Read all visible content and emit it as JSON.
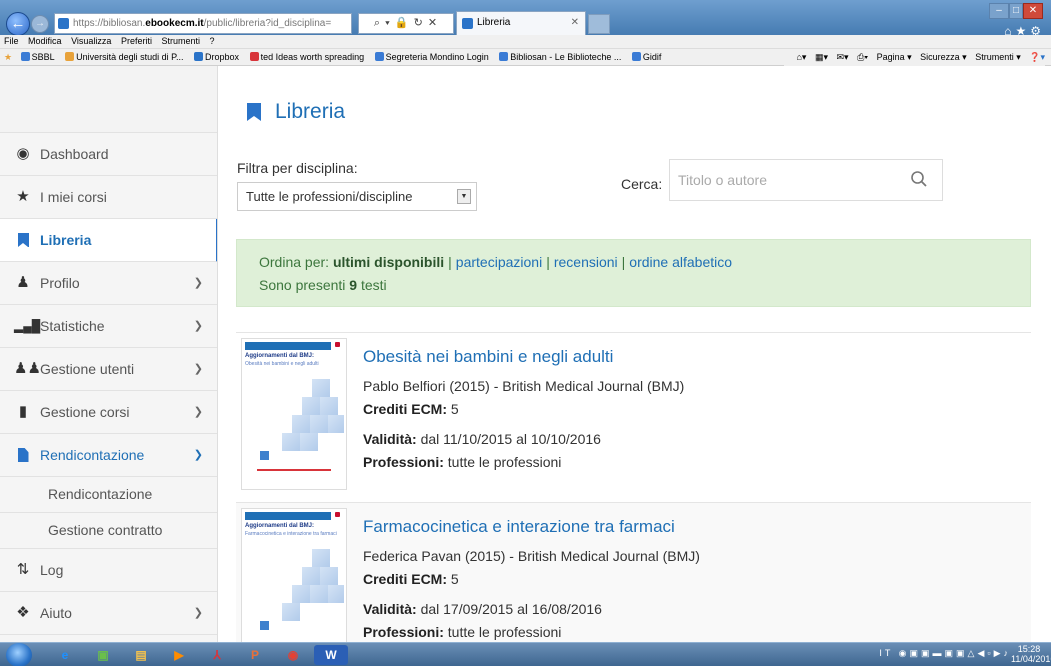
{
  "browser": {
    "url_prefix": "https://bibliosan.",
    "url_domain": "ebookecm.it",
    "url_suffix": "/public/libreria?id_disciplina=",
    "addr_tools": "⌕ ▾ 🔒 ↻ ✕",
    "tab_label": "Libreria",
    "menu": [
      "File",
      "Modifica",
      "Visualizza",
      "Preferiti",
      "Strumenti",
      "?"
    ],
    "favorites": [
      {
        "label": "SBBL",
        "color": "#3a7bd5"
      },
      {
        "label": "Università degli studi di P...",
        "color": "#e8a23a"
      },
      {
        "label": "Dropbox",
        "color": "#2a73c8"
      },
      {
        "label": "ted Ideas worth spreading",
        "color": "#d8343a"
      },
      {
        "label": "Segreteria Mondino Login",
        "color": "#3a7bd5"
      },
      {
        "label": "Bibliosan - Le Biblioteche ...",
        "color": "#3a7bd5"
      },
      {
        "label": "Gidif",
        "color": "#3a7bd5"
      }
    ],
    "command_bar": [
      "Pagina ▾",
      "Sicurezza ▾",
      "Strumenti ▾"
    ]
  },
  "sidebar": {
    "items": [
      {
        "label": "Dashboard",
        "icon": "dashboard-icon"
      },
      {
        "label": "I miei corsi",
        "icon": "star-icon"
      },
      {
        "label": "Libreria",
        "icon": "bookmark-icon",
        "active": true
      },
      {
        "label": "Profilo",
        "icon": "user-icon"
      },
      {
        "label": "Statistiche",
        "icon": "bar-chart-icon"
      },
      {
        "label": "Gestione utenti",
        "icon": "users-icon"
      },
      {
        "label": "Gestione corsi",
        "icon": "book-icon"
      },
      {
        "label": "Rendicontazione",
        "icon": "file-icon",
        "open": true
      },
      {
        "label": "Log",
        "icon": "sort-icon"
      },
      {
        "label": "Aiuto",
        "icon": "info-icon"
      }
    ],
    "sub_items": [
      "Rendicontazione",
      "Gestione contratto"
    ]
  },
  "main": {
    "title": "Libreria",
    "filter": {
      "label": "Filtra per disciplina:",
      "selected": "Tutte le professioni/discipline"
    },
    "search": {
      "label": "Cerca:",
      "placeholder": "Titolo o autore",
      "value": ""
    },
    "sort": {
      "prefix": "Ordina per:",
      "selected": "ultimi disponibili",
      "options": [
        "partecipazioni",
        "recensioni",
        "ordine alfabetico"
      ],
      "count_prefix": "Sono presenti",
      "count": "9",
      "count_suffix": "testi"
    },
    "field_labels": {
      "credits": "Crediti ECM:",
      "validity": "Validità:",
      "professions": "Professioni:"
    },
    "books": [
      {
        "title": "Obesità nei bambini e negli adulti",
        "author": "Pablo Belfiori (2015) - British Medical Journal (BMJ)",
        "credits": "5",
        "validity": "dal 11/10/2015 al 10/10/2016",
        "professions": "tutte le professioni",
        "cover_header": "Aggiornamenti dal BMJ:",
        "cover_subtitle": "Obesità nei bambini e negli adulti"
      },
      {
        "title": "Farmacocinetica e interazione tra farmaci",
        "author": "Federica Pavan (2015) - British Medical Journal (BMJ)",
        "credits": "5",
        "validity": "dal 17/09/2015 al 16/08/2016",
        "professions": "tutte le professioni",
        "cover_header": "Aggiornamenti dal BMJ:",
        "cover_subtitle": "Farmacocinetica e interazione tra farmaci"
      }
    ]
  },
  "taskbar": {
    "apps": [
      {
        "icon": "ie-icon",
        "glyph": "e",
        "color": "#1e90ff"
      },
      {
        "icon": "media-center-icon",
        "glyph": "▣",
        "color": "#6abf4b"
      },
      {
        "icon": "explorer-icon",
        "glyph": "▤",
        "color": "#f2c14e"
      },
      {
        "icon": "media-player-icon",
        "glyph": "▶",
        "color": "#ff8c00"
      },
      {
        "icon": "acrobat-icon",
        "glyph": "⅄",
        "color": "#d8343a"
      },
      {
        "icon": "powerpoint-icon",
        "glyph": "P",
        "color": "#e8703a"
      },
      {
        "icon": "chrome-icon",
        "glyph": "◉",
        "color": "#e34133"
      },
      {
        "icon": "word-icon",
        "glyph": "W",
        "color": "#2b5fb5"
      }
    ],
    "tray_lang": "IT",
    "clock_time": "15:28",
    "clock_date": "11/04/2016"
  }
}
